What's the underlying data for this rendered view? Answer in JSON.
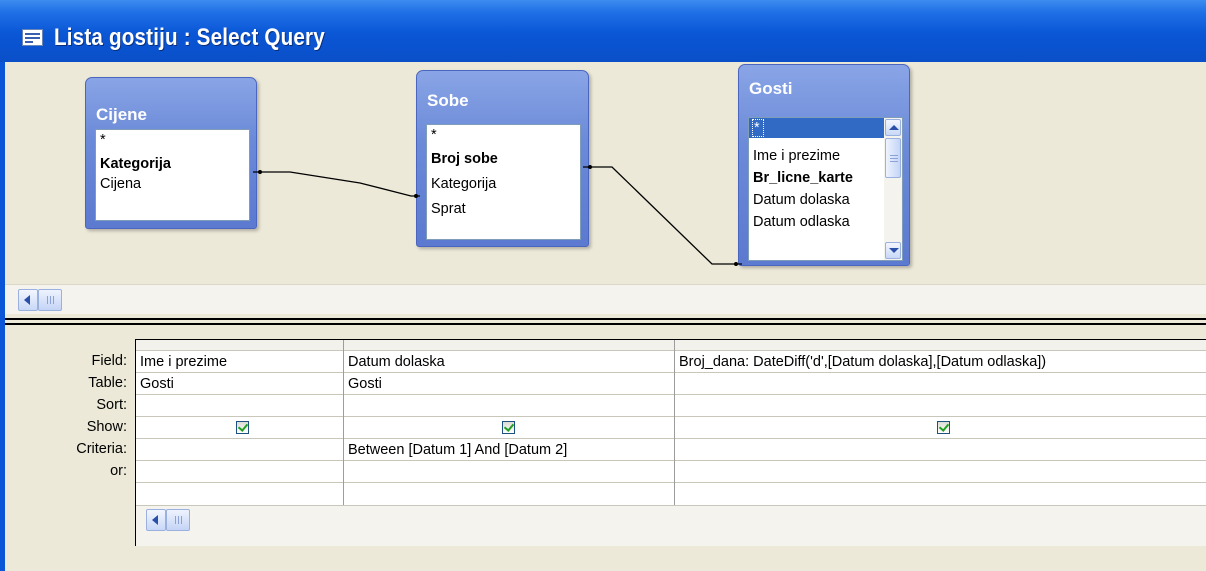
{
  "window": {
    "title": "Lista gostiju : Select Query"
  },
  "tables": {
    "cijene": {
      "title": "Cijene",
      "fields": [
        "*",
        "Kategorija",
        "Cijena"
      ]
    },
    "sobe": {
      "title": "Sobe",
      "fields": [
        "*",
        "Broj sobe",
        "Kategorija",
        "Sprat"
      ]
    },
    "gosti": {
      "title": "Gosti",
      "fields": [
        "*",
        "Ime i prezime",
        "Br_licne_karte",
        "Datum dolaska",
        "Datum odlaska"
      ]
    }
  },
  "grid": {
    "row_labels": {
      "field": "Field:",
      "table": "Table:",
      "sort": "Sort:",
      "show": "Show:",
      "criteria": "Criteria:",
      "or": "or:"
    },
    "columns": [
      {
        "field": "Ime i prezime",
        "table": "Gosti",
        "sort": "",
        "show": true,
        "criteria": "",
        "or": ""
      },
      {
        "field": "Datum dolaska",
        "table": "Gosti",
        "sort": "",
        "show": true,
        "criteria": "Between [Datum 1] And [Datum 2]",
        "or": ""
      },
      {
        "field": "Broj_dana: DateDiff('d',[Datum dolaska],[Datum odlaska])",
        "table": "",
        "sort": "",
        "show": true,
        "criteria": "",
        "or": ""
      }
    ]
  },
  "icons": {
    "window": "query-window-icon",
    "scroll_left": "scroll-left-arrow-icon",
    "scroll_up": "scroll-up-arrow-icon",
    "scroll_down": "scroll-down-arrow-icon",
    "check": "checkbox-checked-icon"
  },
  "colors": {
    "titlebar": "#0a56d6",
    "pane_bg": "#ece9d8",
    "field_list_header": "#6b8ad8",
    "selection": "#316ac5",
    "check": "#21a121"
  }
}
